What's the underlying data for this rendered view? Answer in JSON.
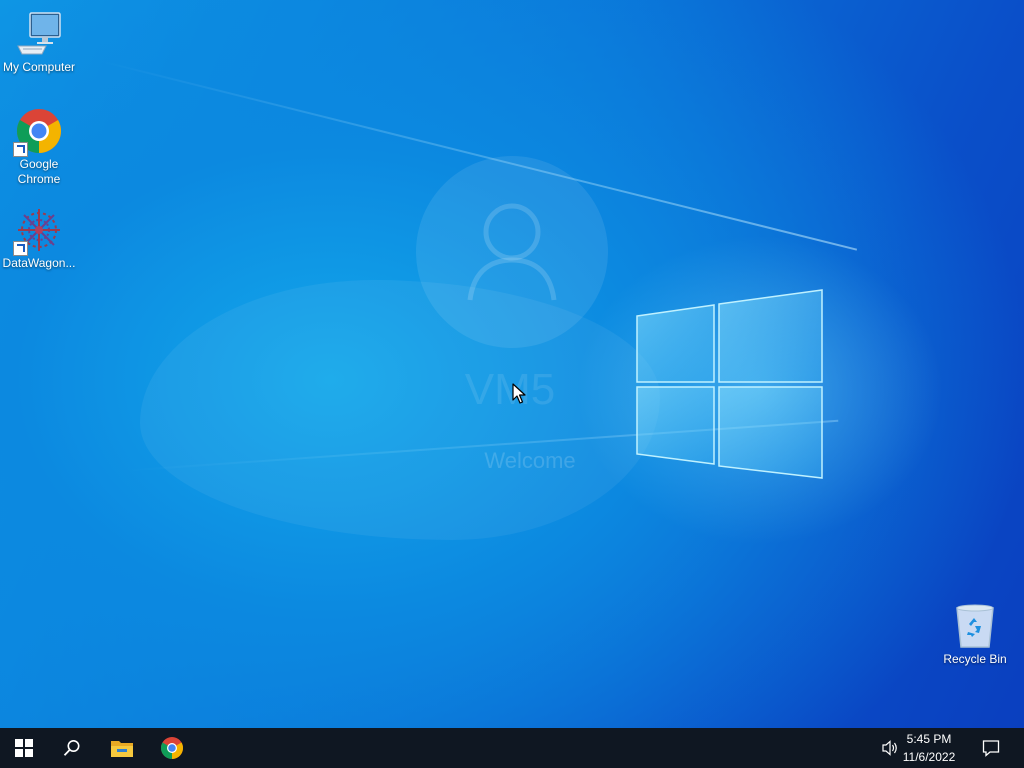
{
  "desktop": {
    "icons": [
      {
        "label": "My Computer",
        "icon": "my-computer-icon"
      },
      {
        "label": "Google\nChrome",
        "icon": "chrome-icon"
      },
      {
        "label": "DataWagon...",
        "icon": "datawagon-icon"
      },
      {
        "label": "Recycle Bin",
        "icon": "recycle-bin-icon"
      }
    ],
    "wallpaper": {
      "name": "VM5",
      "welcome": "Welcome"
    }
  },
  "taskbar": {
    "start": "start-icon",
    "search": "search-icon",
    "pinned": [
      "file-explorer-icon",
      "chrome-icon"
    ],
    "tray": {
      "time": "5:45 PM",
      "date": "11/6/2022",
      "volume": "volume-icon",
      "notifications": "notification-icon"
    }
  },
  "colors": {
    "taskbar": "#0f1722",
    "wallpaper_main": "#0a73d8",
    "logo_glow": "#6fd6ff"
  }
}
